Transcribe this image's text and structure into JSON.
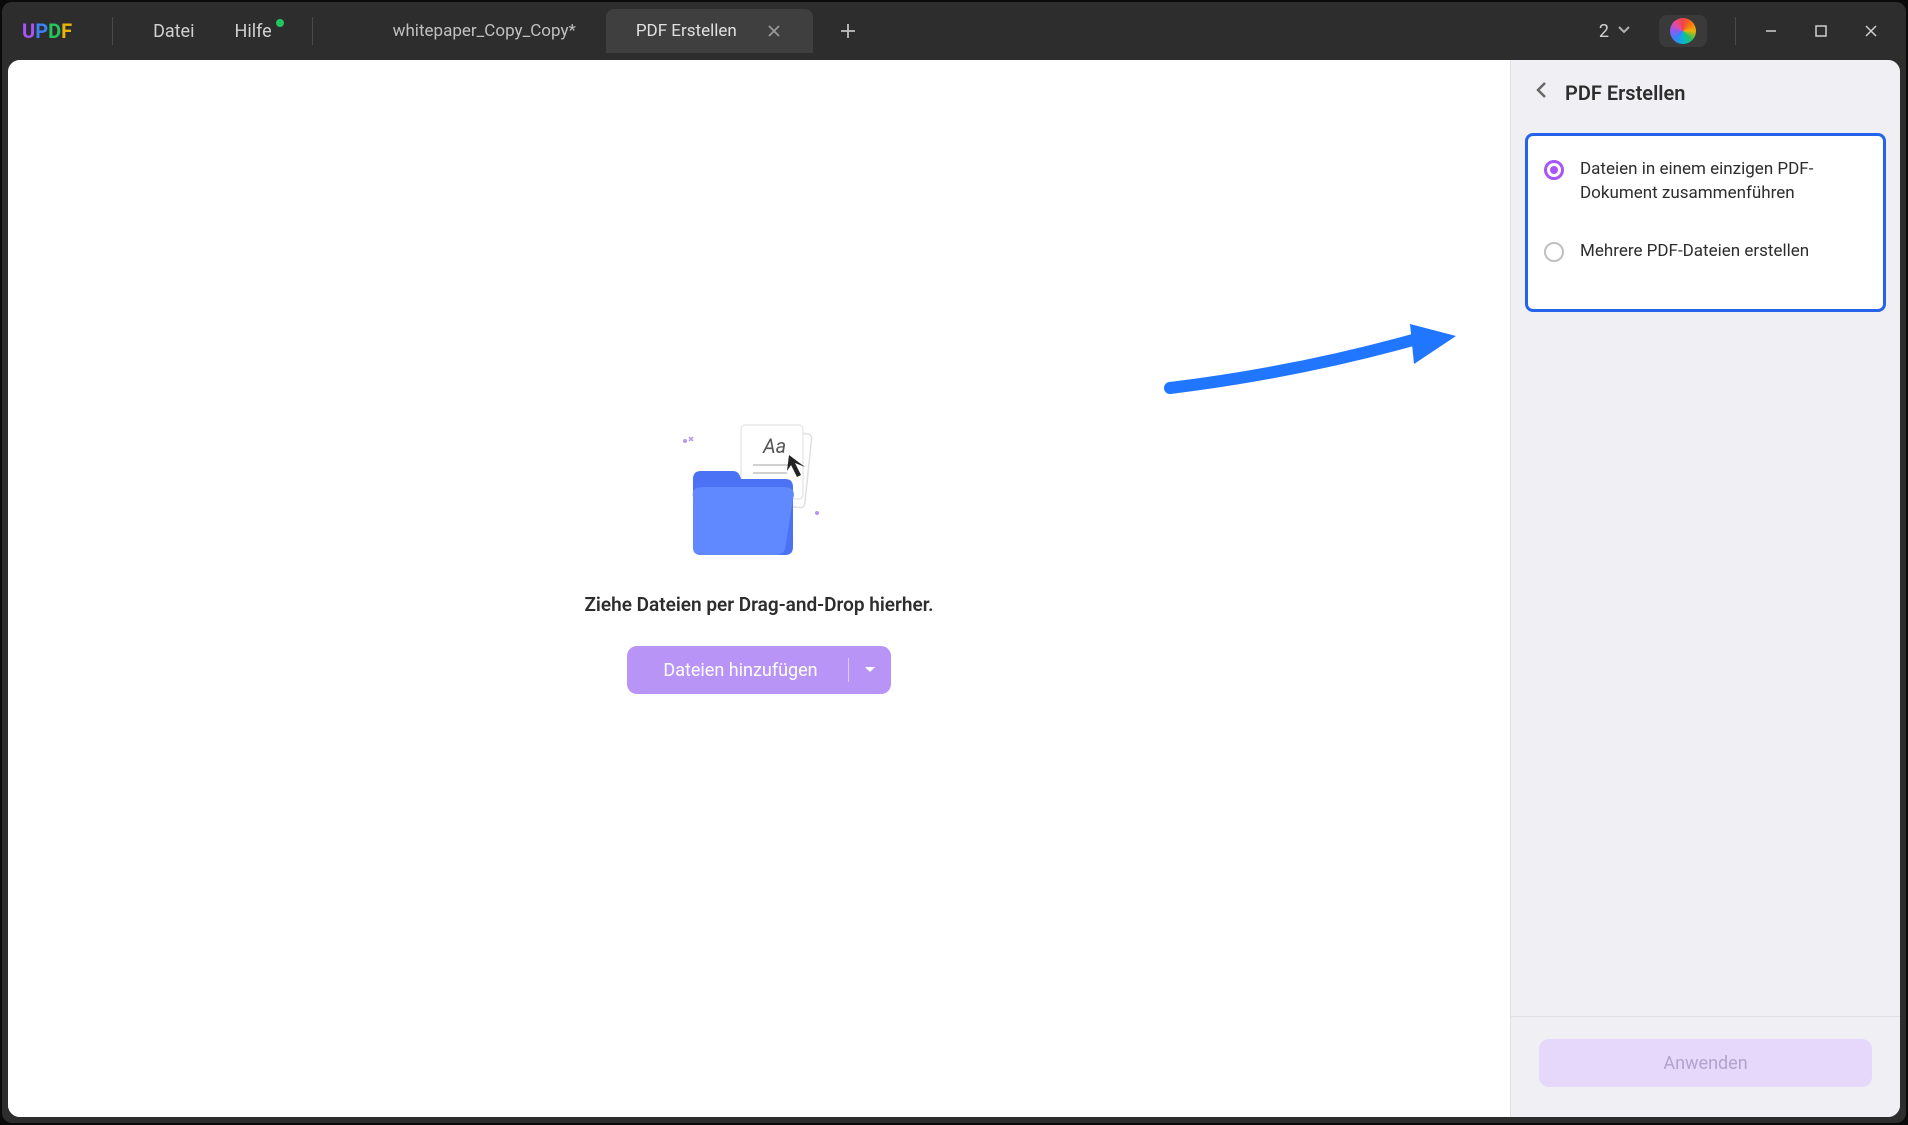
{
  "app": {
    "logo_chars": [
      "U",
      "P",
      "D",
      "F"
    ],
    "menu": {
      "file": "Datei",
      "help": "Hilfe"
    },
    "tabs": [
      {
        "label": "whitepaper_Copy_Copy*",
        "active": false
      },
      {
        "label": "PDF Erstellen",
        "active": true
      }
    ],
    "count_indicator": "2"
  },
  "main": {
    "drop_text": "Ziehe Dateien per Drag-and-Drop hierher.",
    "add_files_label": "Dateien hinzufügen"
  },
  "sidebar": {
    "title": "PDF Erstellen",
    "options": [
      {
        "label": "Dateien in einem einzigen PDF-Dokument zusammenführen",
        "selected": true
      },
      {
        "label": "Mehrere PDF-Dateien erstellen",
        "selected": false
      }
    ],
    "apply_label": "Anwenden"
  }
}
